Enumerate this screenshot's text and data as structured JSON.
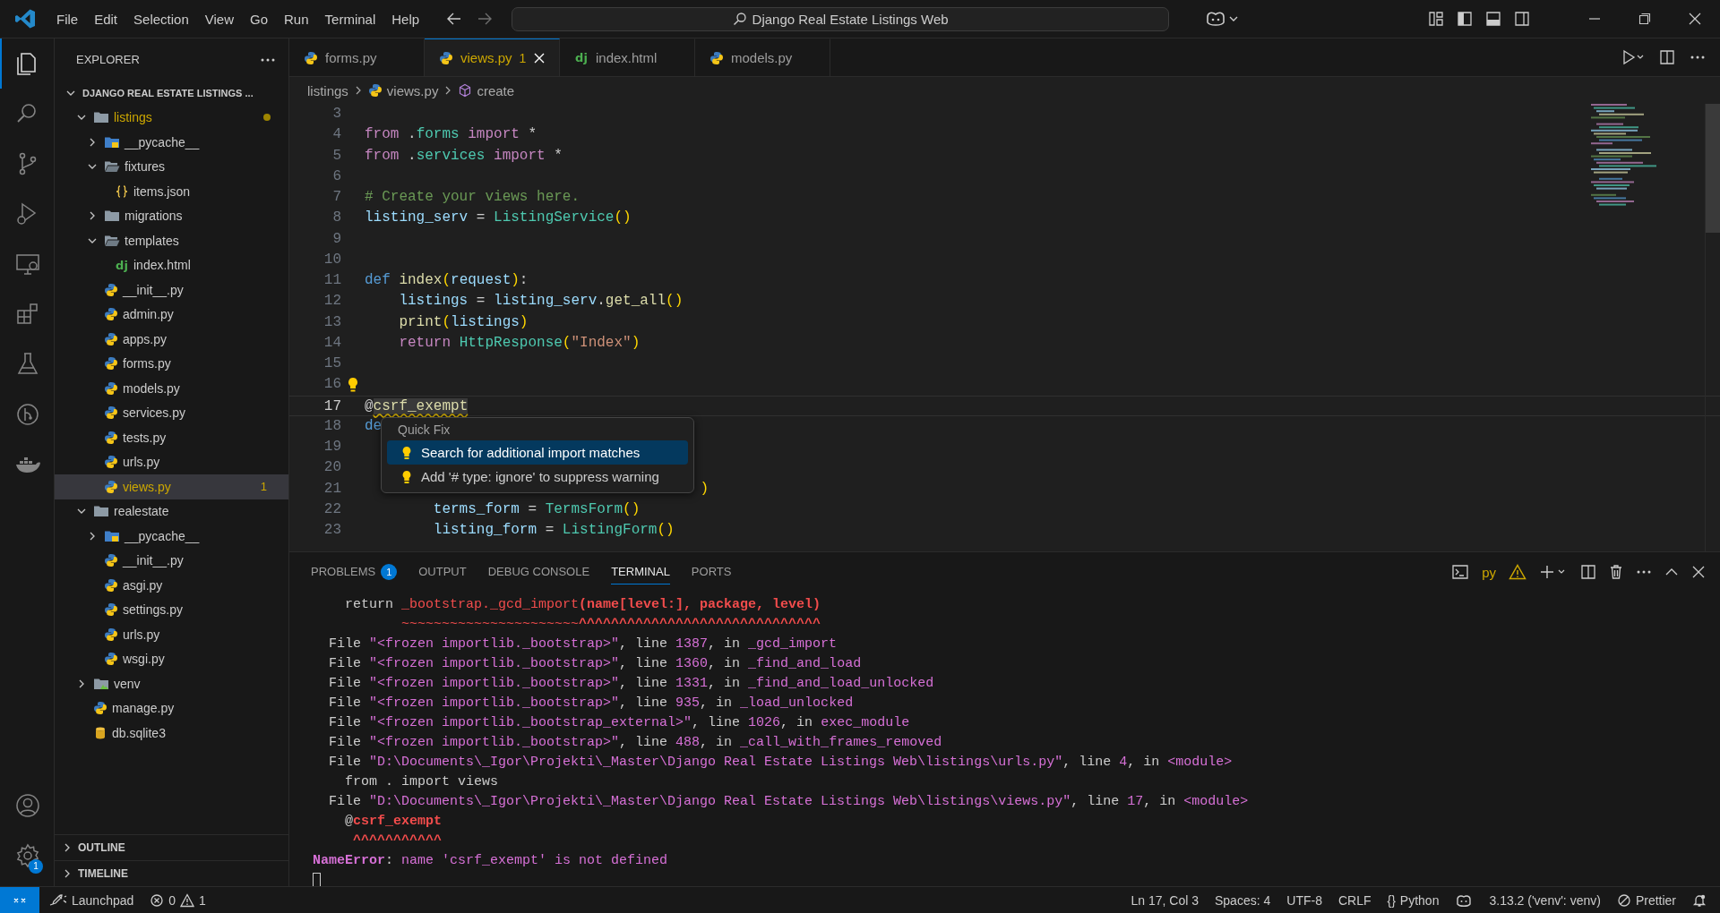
{
  "title_bar": {
    "menus": [
      "File",
      "Edit",
      "Selection",
      "View",
      "Go",
      "Run",
      "Terminal",
      "Help"
    ],
    "search": "Django Real Estate Listings Web"
  },
  "activity_bar": {
    "items": [
      {
        "kind": "files",
        "selected": true
      },
      {
        "kind": "search",
        "selected": false
      },
      {
        "kind": "source-control",
        "selected": false
      },
      {
        "kind": "run-debug",
        "selected": false
      },
      {
        "kind": "remote",
        "selected": false
      },
      {
        "kind": "extensions",
        "selected": false
      },
      {
        "kind": "testing",
        "selected": false
      },
      {
        "kind": "git-graph",
        "selected": false
      },
      {
        "kind": "docker",
        "selected": false
      }
    ],
    "bottom": [
      {
        "kind": "account"
      },
      {
        "kind": "settings",
        "badge": "1"
      }
    ]
  },
  "sidebar": {
    "title": "EXPLORER",
    "tree": [
      {
        "label": "DJANGO REAL ESTATE LISTINGS ...",
        "kind": "root",
        "expanded": true,
        "selected": false,
        "warning": false,
        "children": [
          {
            "label": "listings",
            "kind": "folder",
            "expanded": true,
            "selected": false,
            "warning": true,
            "children": [
              {
                "label": "__pycache__",
                "kind": "folder-pycache",
                "expanded": false,
                "selected": false,
                "warning": false
              },
              {
                "label": "fixtures",
                "kind": "folder-open",
                "expanded": true,
                "selected": false,
                "warning": false,
                "children": [
                  {
                    "label": "items.json",
                    "kind": "json",
                    "selected": false,
                    "warning": false
                  }
                ]
              },
              {
                "label": "migrations",
                "kind": "folder",
                "expanded": false,
                "selected": false,
                "warning": false
              },
              {
                "label": "templates",
                "kind": "folder-open",
                "expanded": true,
                "selected": false,
                "warning": false,
                "children": [
                  {
                    "label": "index.html",
                    "kind": "django",
                    "glyph": "dj",
                    "selected": false,
                    "warning": false
                  }
                ]
              },
              {
                "label": "__init__.py",
                "kind": "python",
                "selected": false,
                "warning": false
              },
              {
                "label": "admin.py",
                "kind": "python",
                "selected": false,
                "warning": false
              },
              {
                "label": "apps.py",
                "kind": "python",
                "selected": false,
                "warning": false
              },
              {
                "label": "forms.py",
                "kind": "python",
                "selected": false,
                "warning": false
              },
              {
                "label": "models.py",
                "kind": "python",
                "selected": false,
                "warning": false
              },
              {
                "label": "services.py",
                "kind": "python",
                "selected": false,
                "warning": false
              },
              {
                "label": "tests.py",
                "kind": "python",
                "selected": false,
                "warning": false
              },
              {
                "label": "urls.py",
                "kind": "python",
                "selected": false,
                "warning": false
              },
              {
                "label": "views.py",
                "kind": "python",
                "selected": true,
                "warning": true,
                "badge": "1"
              }
            ]
          },
          {
            "label": "realestate",
            "kind": "folder",
            "expanded": true,
            "selected": false,
            "warning": false,
            "children": [
              {
                "label": "__pycache__",
                "kind": "folder-pycache",
                "expanded": false,
                "selected": false,
                "warning": false
              },
              {
                "label": "__init__.py",
                "kind": "python",
                "selected": false,
                "warning": false
              },
              {
                "label": "asgi.py",
                "kind": "python",
                "selected": false,
                "warning": false
              },
              {
                "label": "settings.py",
                "kind": "python",
                "selected": false,
                "warning": false
              },
              {
                "label": "urls.py",
                "kind": "python",
                "selected": false,
                "warning": false
              },
              {
                "label": "wsgi.py",
                "kind": "python",
                "selected": false,
                "warning": false
              }
            ]
          },
          {
            "label": "venv",
            "kind": "folder-venv",
            "expanded": false,
            "selected": false,
            "warning": false
          },
          {
            "label": "manage.py",
            "kind": "python",
            "selected": false,
            "warning": false
          },
          {
            "label": "db.sqlite3",
            "kind": "database",
            "selected": false,
            "warning": false
          }
        ]
      }
    ],
    "sections": [
      {
        "label": "OUTLINE",
        "expanded": false
      },
      {
        "label": "TIMELINE",
        "expanded": false
      }
    ]
  },
  "editor": {
    "tabs": [
      {
        "label": "forms.py",
        "kind": "python",
        "selected": false,
        "warning": false
      },
      {
        "label": "views.py",
        "kind": "python",
        "selected": true,
        "warning": true,
        "badge": "1"
      },
      {
        "label": "index.html",
        "kind": "django",
        "glyph": "dj",
        "selected": false,
        "warning": false
      },
      {
        "label": "models.py",
        "kind": "python",
        "selected": false,
        "warning": false
      }
    ],
    "breadcrumb": [
      {
        "label": "listings",
        "kind": "folder"
      },
      {
        "label": "views.py",
        "kind": "python"
      },
      {
        "label": "create",
        "kind": "symbol"
      }
    ],
    "lines": [
      {
        "number": "3",
        "current": false,
        "lightbulb": false
      },
      {
        "number": "4",
        "current": false,
        "lightbulb": false,
        "tokens": [
          {
            "text": "from ",
            "kind": "kw"
          },
          {
            "text": ".",
            "kind": "p"
          },
          {
            "text": "forms ",
            "kind": "cls"
          },
          {
            "text": "import ",
            "kind": "kw"
          },
          {
            "text": "*",
            "kind": "p"
          }
        ]
      },
      {
        "number": "5",
        "current": false,
        "lightbulb": false,
        "tokens": [
          {
            "text": "from ",
            "kind": "kw"
          },
          {
            "text": ".",
            "kind": "p"
          },
          {
            "text": "services ",
            "kind": "cls"
          },
          {
            "text": "import ",
            "kind": "kw"
          },
          {
            "text": "*",
            "kind": "p"
          }
        ]
      },
      {
        "number": "6",
        "current": false,
        "lightbulb": false
      },
      {
        "number": "7",
        "current": false,
        "lightbulb": false,
        "tokens": [
          {
            "text": "# Create your views here.",
            "kind": "com"
          }
        ]
      },
      {
        "number": "8",
        "current": false,
        "lightbulb": false,
        "tokens": [
          {
            "text": "listing_serv",
            "kind": "var"
          },
          {
            "text": " = ",
            "kind": "p"
          },
          {
            "text": "ListingService",
            "kind": "cls"
          },
          {
            "text": "()",
            "kind": "br"
          }
        ]
      },
      {
        "number": "9",
        "current": false,
        "lightbulb": false
      },
      {
        "number": "10",
        "current": false,
        "lightbulb": false
      },
      {
        "number": "11",
        "current": false,
        "lightbulb": false,
        "tokens": [
          {
            "text": "def ",
            "kind": "def"
          },
          {
            "text": "index",
            "kind": "fn"
          },
          {
            "text": "(",
            "kind": "br"
          },
          {
            "text": "request",
            "kind": "var"
          },
          {
            "text": ")",
            "kind": "br"
          },
          {
            "text": ":",
            "kind": "p"
          }
        ]
      },
      {
        "number": "12",
        "current": false,
        "lightbulb": false,
        "tokens": [
          {
            "text": "    listings",
            "kind": "var"
          },
          {
            "text": " = ",
            "kind": "p"
          },
          {
            "text": "listing_serv",
            "kind": "var"
          },
          {
            "text": ".",
            "kind": "p"
          },
          {
            "text": "get_all",
            "kind": "fn"
          },
          {
            "text": "()",
            "kind": "br"
          }
        ]
      },
      {
        "number": "13",
        "current": false,
        "lightbulb": false,
        "tokens": [
          {
            "text": "    print",
            "kind": "fn"
          },
          {
            "text": "(",
            "kind": "br"
          },
          {
            "text": "listings",
            "kind": "var"
          },
          {
            "text": ")",
            "kind": "br"
          }
        ]
      },
      {
        "number": "14",
        "current": false,
        "lightbulb": false,
        "tokens": [
          {
            "text": "    return ",
            "kind": "kw"
          },
          {
            "text": "HttpResponse",
            "kind": "cls"
          },
          {
            "text": "(",
            "kind": "br"
          },
          {
            "text": "\"Index\"",
            "kind": "str"
          },
          {
            "text": ")",
            "kind": "br"
          }
        ]
      },
      {
        "number": "15",
        "current": false,
        "lightbulb": false
      },
      {
        "number": "16",
        "current": false,
        "lightbulb": true
      },
      {
        "number": "17",
        "current": true,
        "lightbulb": false,
        "tokens": [
          {
            "text": "@",
            "kind": "p"
          },
          {
            "text": "csrf_exempt",
            "kind": "warn"
          }
        ]
      },
      {
        "number": "18",
        "current": false,
        "lightbulb": false,
        "tokens": [
          {
            "text": "de",
            "kind": "def"
          }
        ]
      },
      {
        "number": "19",
        "current": false,
        "lightbulb": false
      },
      {
        "number": "20",
        "current": false,
        "lightbulb": false
      },
      {
        "number": "21",
        "current": false,
        "lightbulb": false,
        "covered": true,
        "tokens": [
          {
            "text": ")",
            "kind": "br"
          }
        ]
      },
      {
        "number": "22",
        "current": false,
        "lightbulb": false,
        "tokens": [
          {
            "text": "        terms_form",
            "kind": "var"
          },
          {
            "text": " = ",
            "kind": "p"
          },
          {
            "text": "TermsForm",
            "kind": "cls"
          },
          {
            "text": "()",
            "kind": "br"
          }
        ]
      },
      {
        "number": "23",
        "current": false,
        "lightbulb": false,
        "tokens": [
          {
            "text": "        listing_form",
            "kind": "var"
          },
          {
            "text": " = ",
            "kind": "p"
          },
          {
            "text": "ListingForm",
            "kind": "cls"
          },
          {
            "text": "()",
            "kind": "br"
          }
        ]
      }
    ],
    "quick_fix": {
      "title": "Quick Fix",
      "items": [
        {
          "label": "Search for additional import matches",
          "selected": true
        },
        {
          "label": "Add '# type: ignore' to suppress warning",
          "selected": false
        }
      ]
    }
  },
  "panel": {
    "tabs": [
      {
        "label": "PROBLEMS",
        "badge": "1",
        "selected": false
      },
      {
        "label": "OUTPUT",
        "selected": false
      },
      {
        "label": "DEBUG CONSOLE",
        "selected": false
      },
      {
        "label": "TERMINAL",
        "selected": true
      },
      {
        "label": "PORTS",
        "selected": false
      }
    ],
    "terminal_name": "py",
    "lines": [
      [
        {
          "text": "    return ",
          "kind": "p"
        },
        {
          "text": "_bootstrap._gcd_import",
          "kind": "r"
        },
        {
          "text": "(name[level:], package, level)",
          "kind": "rb"
        }
      ],
      [
        {
          "text": "           ~~~~~~~~~~~~~~~~~~~~~~",
          "kind": "r"
        },
        {
          "text": "^^^^^^^^^^^^^^^^^^^^^^^^^^^^^^",
          "kind": "rb"
        }
      ],
      [
        {
          "text": "  File ",
          "kind": "p"
        },
        {
          "text": "\"<frozen importlib._bootstrap>\"",
          "kind": "m"
        },
        {
          "text": ", line ",
          "kind": "p"
        },
        {
          "text": "1387",
          "kind": "m"
        },
        {
          "text": ", in ",
          "kind": "p"
        },
        {
          "text": "_gcd_import",
          "kind": "m"
        }
      ],
      [
        {
          "text": "  File ",
          "kind": "p"
        },
        {
          "text": "\"<frozen importlib._bootstrap>\"",
          "kind": "m"
        },
        {
          "text": ", line ",
          "kind": "p"
        },
        {
          "text": "1360",
          "kind": "m"
        },
        {
          "text": ", in ",
          "kind": "p"
        },
        {
          "text": "_find_and_load",
          "kind": "m"
        }
      ],
      [
        {
          "text": "  File ",
          "kind": "p"
        },
        {
          "text": "\"<frozen importlib._bootstrap>\"",
          "kind": "m"
        },
        {
          "text": ", line ",
          "kind": "p"
        },
        {
          "text": "1331",
          "kind": "m"
        },
        {
          "text": ", in ",
          "kind": "p"
        },
        {
          "text": "_find_and_load_unlocked",
          "kind": "m"
        }
      ],
      [
        {
          "text": "  File ",
          "kind": "p"
        },
        {
          "text": "\"<frozen importlib._bootstrap>\"",
          "kind": "m"
        },
        {
          "text": ", line ",
          "kind": "p"
        },
        {
          "text": "935",
          "kind": "m"
        },
        {
          "text": ", in ",
          "kind": "p"
        },
        {
          "text": "_load_unlocked",
          "kind": "m"
        }
      ],
      [
        {
          "text": "  File ",
          "kind": "p"
        },
        {
          "text": "\"<frozen importlib._bootstrap_external>\"",
          "kind": "m"
        },
        {
          "text": ", line ",
          "kind": "p"
        },
        {
          "text": "1026",
          "kind": "m"
        },
        {
          "text": ", in ",
          "kind": "p"
        },
        {
          "text": "exec_module",
          "kind": "m"
        }
      ],
      [
        {
          "text": "  File ",
          "kind": "p"
        },
        {
          "text": "\"<frozen importlib._bootstrap>\"",
          "kind": "m"
        },
        {
          "text": ", line ",
          "kind": "p"
        },
        {
          "text": "488",
          "kind": "m"
        },
        {
          "text": ", in ",
          "kind": "p"
        },
        {
          "text": "_call_with_frames_removed",
          "kind": "m"
        }
      ],
      [
        {
          "text": "  File ",
          "kind": "p"
        },
        {
          "text": "\"D:\\Documents\\_Igor\\Projekti\\_Master\\Django Real Estate Listings Web\\listings\\urls.py\"",
          "kind": "m"
        },
        {
          "text": ", line ",
          "kind": "p"
        },
        {
          "text": "4",
          "kind": "m"
        },
        {
          "text": ", in ",
          "kind": "p"
        },
        {
          "text": "<module>",
          "kind": "m"
        }
      ],
      [
        {
          "text": "    from . import views",
          "kind": "p"
        }
      ],
      [
        {
          "text": "  File ",
          "kind": "p"
        },
        {
          "text": "\"D:\\Documents\\_Igor\\Projekti\\_Master\\Django Real Estate Listings Web\\listings\\views.py\"",
          "kind": "m"
        },
        {
          "text": ", line ",
          "kind": "p"
        },
        {
          "text": "17",
          "kind": "m"
        },
        {
          "text": ", in ",
          "kind": "p"
        },
        {
          "text": "<module>",
          "kind": "m"
        }
      ],
      [
        {
          "text": "    @",
          "kind": "p"
        },
        {
          "text": "csrf_exempt",
          "kind": "rb"
        }
      ],
      [
        {
          "text": "     ^^^^^^^^^^^",
          "kind": "rb"
        }
      ],
      [
        {
          "text": "NameError",
          "kind": "mb"
        },
        {
          "text": ": ",
          "kind": "p"
        },
        {
          "text": "name 'csrf_exempt' is not defined",
          "kind": "m"
        }
      ]
    ]
  },
  "status_bar": {
    "left": [
      {
        "kind": "remote"
      },
      {
        "kind": "launchpad",
        "text": "Launchpad"
      },
      {
        "kind": "problems",
        "errors": "0",
        "warnings": "1"
      }
    ],
    "right": [
      {
        "kind": "text",
        "text": "Ln 17, Col 3"
      },
      {
        "kind": "text",
        "text": "Spaces: 4"
      },
      {
        "kind": "text",
        "text": "UTF-8"
      },
      {
        "kind": "text",
        "text": "CRLF"
      },
      {
        "kind": "language",
        "glyph": "{}",
        "text": "Python"
      },
      {
        "kind": "copilot"
      },
      {
        "kind": "text",
        "text": "3.13.2 ('venv': venv)"
      },
      {
        "kind": "prettier",
        "text": "Prettier"
      },
      {
        "kind": "bell"
      }
    ]
  }
}
